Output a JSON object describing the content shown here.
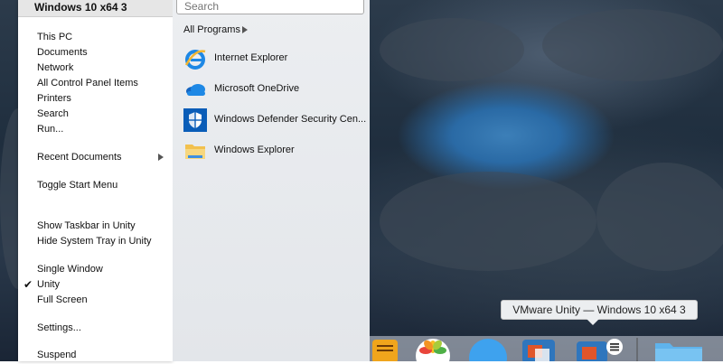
{
  "window_title": "Windows 10 x64 3",
  "left_menu": [
    {
      "label": "This PC"
    },
    {
      "label": "Documents"
    },
    {
      "label": "Network"
    },
    {
      "label": "All Control Panel Items"
    },
    {
      "label": "Printers"
    },
    {
      "label": "Search"
    },
    {
      "label": "Run..."
    },
    {
      "label": "Recent Documents",
      "submenu": true
    },
    {
      "label": "Toggle Start Menu"
    },
    {
      "label": "Show Taskbar in Unity"
    },
    {
      "label": "Hide System Tray in Unity"
    },
    {
      "label": "Single Window"
    },
    {
      "label": "Unity",
      "checked": true
    },
    {
      "label": "Full Screen"
    },
    {
      "label": "Settings..."
    },
    {
      "label": "Suspend"
    }
  ],
  "search": {
    "placeholder": "Search",
    "value": ""
  },
  "all_programs_label": "All Programs",
  "programs": [
    {
      "label": "Internet Explorer",
      "icon": "internet-explorer-icon"
    },
    {
      "label": "Microsoft OneDrive",
      "icon": "onedrive-icon"
    },
    {
      "label": "Windows Defender Security Cen...",
      "icon": "defender-shield-icon"
    },
    {
      "label": "Windows Explorer",
      "icon": "folder-icon"
    }
  ],
  "tooltip": "VMware Unity — Windows 10 x64 3",
  "dock_items": [
    "notes-icon",
    "photos-icon",
    "messages-icon",
    "vmware-fusion-icon",
    "vmware-unity-icon",
    "folder-icon"
  ],
  "colors": {
    "menu_bg": "#ffffff",
    "right_pane_bg": "#e6e9ed",
    "accent_blue": "#1a73c8"
  }
}
